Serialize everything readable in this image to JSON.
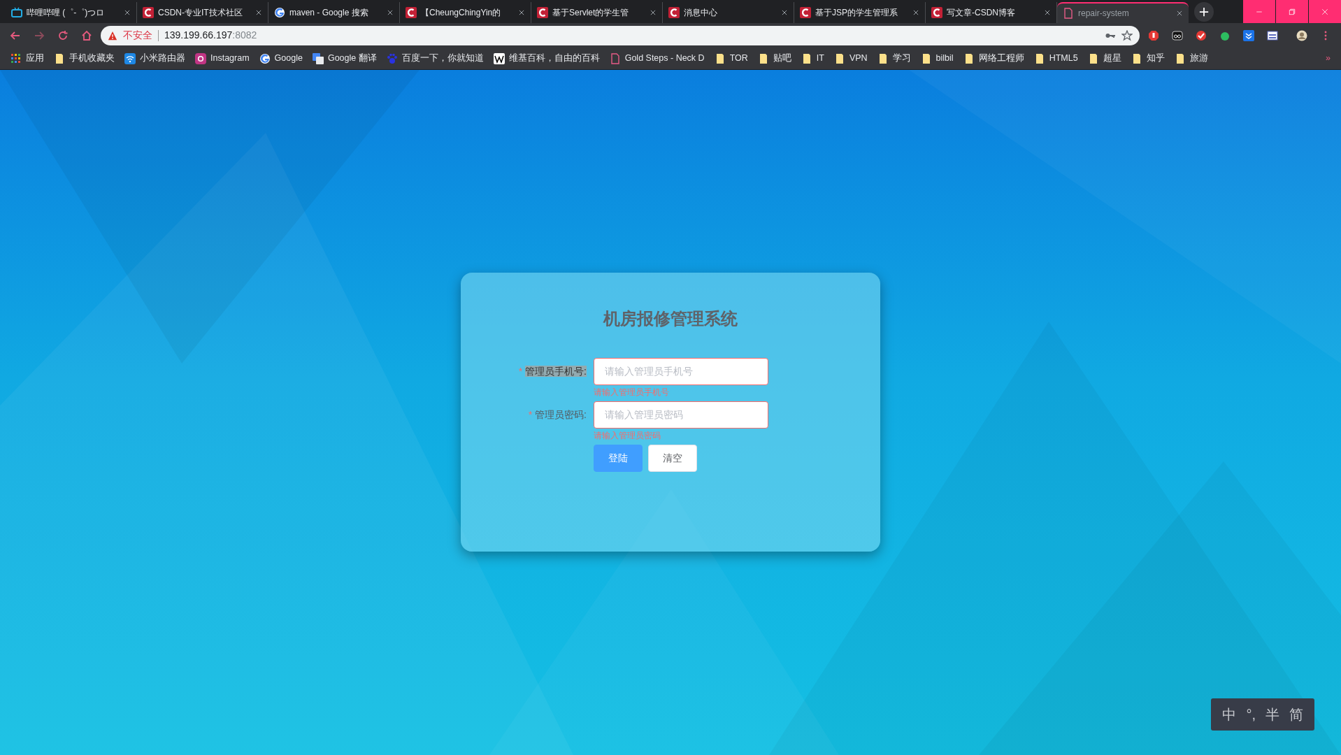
{
  "browser": {
    "tabs": [
      {
        "title": "哔哩哔哩 (゜-゜)つロ",
        "kind": "bilibili",
        "selected": false
      },
      {
        "title": "CSDN-专业IT技术社区",
        "kind": "csdn",
        "selected": false
      },
      {
        "title": "maven - Google 搜索",
        "kind": "google",
        "selected": false
      },
      {
        "title": "【CheungChingYin的",
        "kind": "csdn",
        "selected": false
      },
      {
        "title": "基于Servlet的学生管",
        "kind": "csdn",
        "selected": false
      },
      {
        "title": "消息中心",
        "kind": "csdn",
        "selected": false
      },
      {
        "title": "基于JSP的学生管理系",
        "kind": "csdn",
        "selected": false
      },
      {
        "title": "写文章-CSDN博客",
        "kind": "csdn",
        "selected": false
      },
      {
        "title": "repair-system",
        "kind": "page",
        "selected": true
      }
    ],
    "address": {
      "security": "不安全",
      "host": "139.199.66.197",
      "port": ":8082"
    },
    "bookmarks": [
      {
        "label": "应用",
        "kind": "apps"
      },
      {
        "label": "手机收藏夹",
        "kind": "folder"
      },
      {
        "label": "小米路由器",
        "kind": "wifi"
      },
      {
        "label": "Instagram",
        "kind": "instagram"
      },
      {
        "label": "Google",
        "kind": "google"
      },
      {
        "label": "Google 翻译",
        "kind": "translate"
      },
      {
        "label": "百度一下，你就知道",
        "kind": "baidu"
      },
      {
        "label": "维基百科，自由的百科",
        "kind": "wiki"
      },
      {
        "label": "Gold Steps - Neck D",
        "kind": "page"
      },
      {
        "label": "TOR",
        "kind": "folder"
      },
      {
        "label": "贴吧",
        "kind": "folder"
      },
      {
        "label": "IT",
        "kind": "folder"
      },
      {
        "label": "VPN",
        "kind": "folder"
      },
      {
        "label": "学习",
        "kind": "folder"
      },
      {
        "label": "bilbil",
        "kind": "folder"
      },
      {
        "label": "网络工程师",
        "kind": "folder"
      },
      {
        "label": "HTML5",
        "kind": "folder"
      },
      {
        "label": "超星",
        "kind": "folder"
      },
      {
        "label": "知乎",
        "kind": "folder"
      },
      {
        "label": "旅游",
        "kind": "folder"
      }
    ],
    "more": "»"
  },
  "login": {
    "title": "机房报修管理系统",
    "fields": [
      {
        "required": "*",
        "label": "管理员手机号:",
        "highlighted": true,
        "placeholder": "请输入管理员手机号",
        "invalid": true,
        "error": "请输入管理员手机号"
      },
      {
        "required": "*",
        "label": "管理员密码:",
        "highlighted": false,
        "placeholder": "请输入管理员密码",
        "invalid": true,
        "error": "请输入管理员密码"
      }
    ],
    "buttons": [
      {
        "label": "登陆",
        "kind": "primary"
      },
      {
        "label": "清空",
        "kind": "plain"
      }
    ]
  },
  "ime": {
    "items": [
      "中",
      "°,",
      "半",
      "简"
    ]
  }
}
